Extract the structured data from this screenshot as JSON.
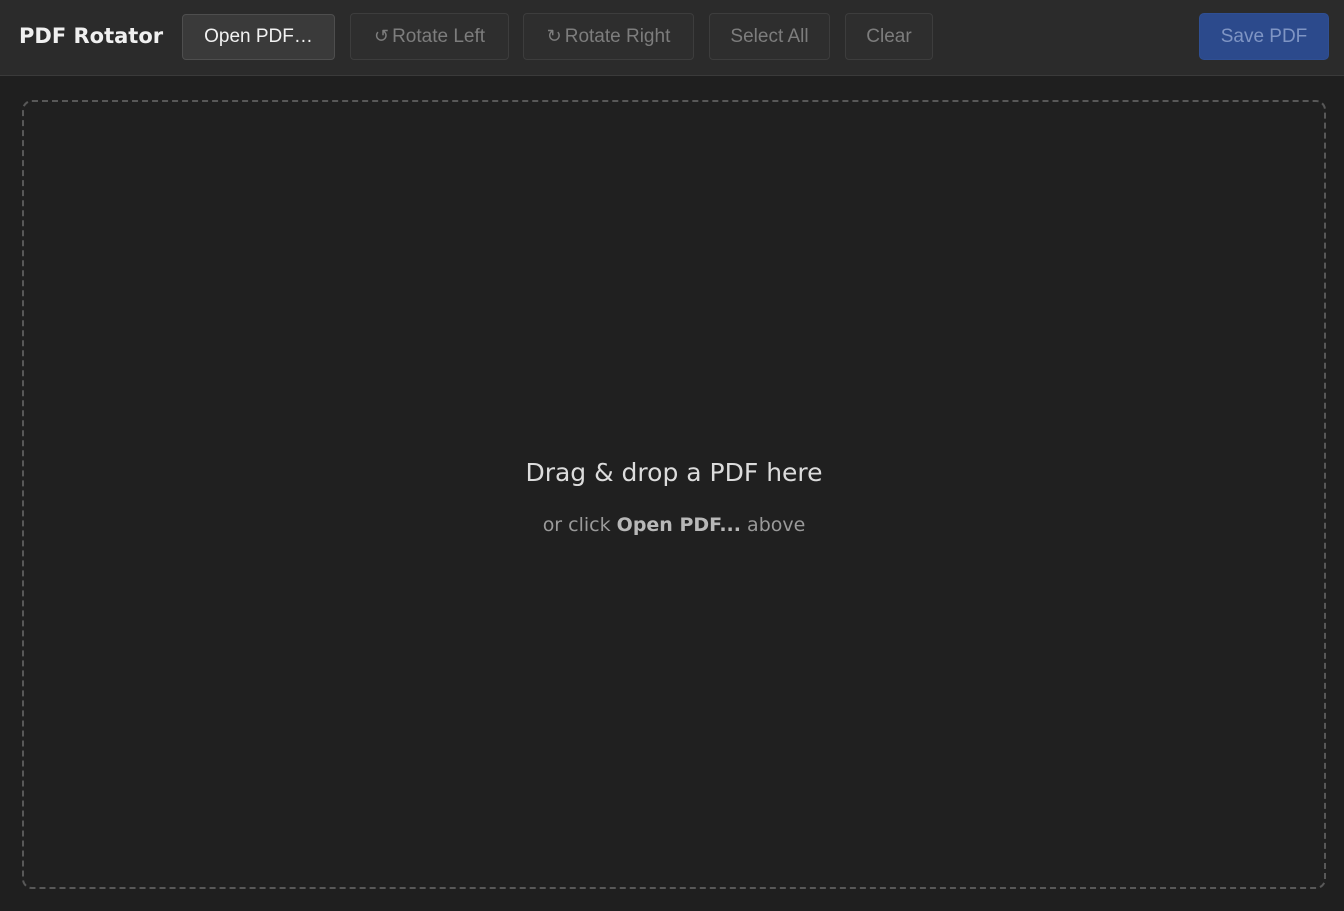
{
  "app": {
    "title": "PDF Rotator"
  },
  "toolbar": {
    "open_label": "Open PDF…",
    "rotate_left_icon": "↺",
    "rotate_left_label": "Rotate Left",
    "rotate_right_icon": "↻",
    "rotate_right_label": "Rotate Right",
    "select_all_label": "Select All",
    "clear_label": "Clear",
    "save_label": "Save PDF"
  },
  "dropzone": {
    "main_text": "Drag & drop a PDF here",
    "sub_prefix": "or click",
    "sub_emphasis": "Open PDF...",
    "sub_suffix": "above"
  },
  "colors": {
    "background": "#1f1f1f",
    "toolbar": "#2b2b2b",
    "save_accent": "#2c4a8c"
  }
}
